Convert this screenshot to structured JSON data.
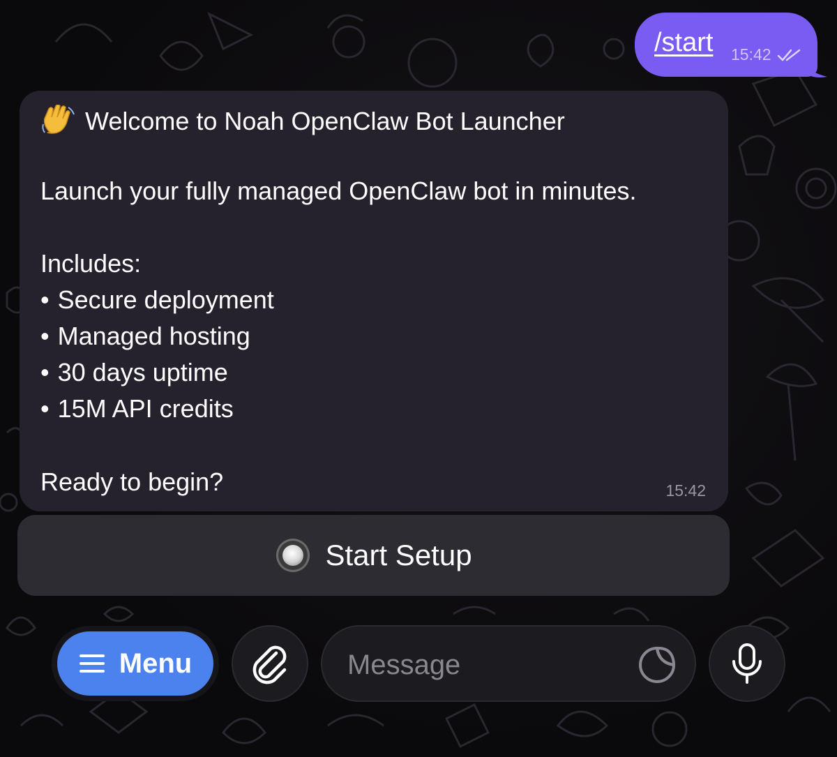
{
  "outgoing_message": {
    "text": "/start",
    "time": "15:42",
    "status_icon": "double-check-icon"
  },
  "incoming_message": {
    "greeting_icon": "waving-hand-icon",
    "title": "Welcome to Noah OpenClaw Bot Launcher",
    "intro": "Launch your fully managed OpenClaw bot in minutes.",
    "includes_heading": "Includes:",
    "bullet": "•",
    "features": [
      "Secure deployment",
      "Managed hosting",
      "30 days uptime",
      "15M API credits"
    ],
    "closing": "Ready to begin?",
    "time": "15:42"
  },
  "inline_keyboard": {
    "button_icon": "radio-button-icon",
    "button_label": "Start Setup"
  },
  "composer": {
    "menu_label": "Menu",
    "menu_icon": "hamburger-icon",
    "attach_icon": "paperclip-icon",
    "placeholder": "Message",
    "sticker_icon": "sticker-icon",
    "mic_icon": "microphone-icon"
  },
  "colors": {
    "outgoing_bubble": "#7b5cf2",
    "incoming_bubble": "#25222d",
    "menu_button": "#4b82ee",
    "background": "#0a090b"
  }
}
